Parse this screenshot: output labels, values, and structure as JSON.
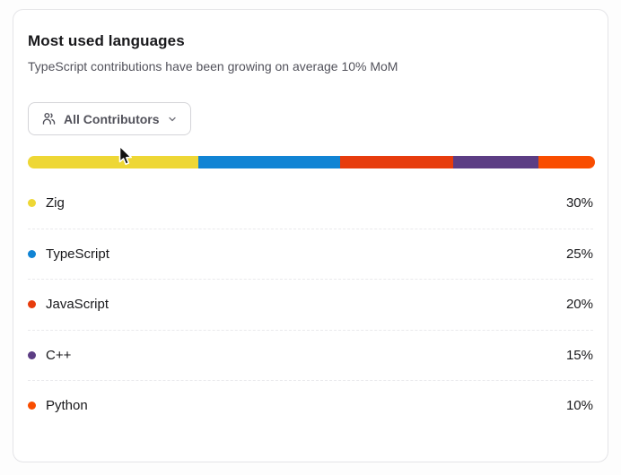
{
  "card": {
    "title": "Most used languages",
    "subtitle": "TypeScript contributions have been growing on average 10% MoM",
    "filter": {
      "label": "All Contributors",
      "icon": "users-icon",
      "chevron": "chevron-down-icon"
    }
  },
  "chart_data": {
    "type": "bar",
    "variant": "horizontal-stacked",
    "title": "Most used languages",
    "categories": [
      "Zig",
      "TypeScript",
      "JavaScript",
      "C++",
      "Python"
    ],
    "values": [
      30,
      25,
      20,
      15,
      10
    ],
    "unit": "%",
    "legend_position": "below",
    "colors": [
      "#eed735",
      "#1184d4",
      "#e73c0d",
      "#5c3d84",
      "#f94d00"
    ]
  },
  "languages": [
    {
      "name": "Zig",
      "value": 30,
      "percent_label": "30%",
      "width": "30%",
      "color": "#eed735"
    },
    {
      "name": "TypeScript",
      "value": 25,
      "percent_label": "25%",
      "width": "25%",
      "color": "#1184d4"
    },
    {
      "name": "JavaScript",
      "value": 20,
      "percent_label": "20%",
      "width": "20%",
      "color": "#e73c0d"
    },
    {
      "name": "C++",
      "value": 15,
      "percent_label": "15%",
      "width": "15%",
      "color": "#5c3d84"
    },
    {
      "name": "Python",
      "value": 10,
      "percent_label": "10%",
      "width": "10%",
      "color": "#f94d00"
    }
  ]
}
